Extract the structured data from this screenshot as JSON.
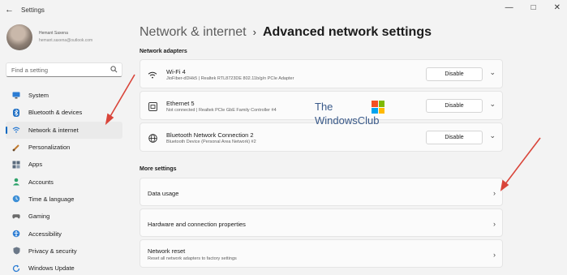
{
  "window": {
    "title": "Settings",
    "controls": [
      "—",
      "□",
      "✕"
    ]
  },
  "profile": {
    "name": "Hemant Saxena",
    "email": "hemant.saxena@outlook.com"
  },
  "search": {
    "placeholder": "Find a setting"
  },
  "sidebar": {
    "items": [
      {
        "label": "System",
        "icon": "monitor-icon",
        "active": false
      },
      {
        "label": "Bluetooth & devices",
        "icon": "bluetooth-icon",
        "active": false
      },
      {
        "label": "Network & internet",
        "icon": "wifi-icon",
        "active": true
      },
      {
        "label": "Personalization",
        "icon": "brush-icon",
        "active": false
      },
      {
        "label": "Apps",
        "icon": "apps-icon",
        "active": false
      },
      {
        "label": "Accounts",
        "icon": "person-icon",
        "active": false
      },
      {
        "label": "Time & language",
        "icon": "globe-clock-icon",
        "active": false
      },
      {
        "label": "Gaming",
        "icon": "gamepad-icon",
        "active": false
      },
      {
        "label": "Accessibility",
        "icon": "accessibility-icon",
        "active": false
      },
      {
        "label": "Privacy & security",
        "icon": "shield-icon",
        "active": false
      },
      {
        "label": "Windows Update",
        "icon": "update-icon",
        "active": false
      }
    ]
  },
  "breadcrumb": {
    "parent": "Network & internet",
    "separator": "›",
    "current": "Advanced network settings"
  },
  "network_adapters": {
    "title": "Network adapters",
    "items": [
      {
        "name": "Wi-Fi 4",
        "detail": "JioFiber-dDHk5 | Realtek RTL8723DE 802.11b/g/n PCIe Adapter",
        "button": "Disable",
        "icon": "wifi-icon"
      },
      {
        "name": "Ethernet 5",
        "detail": "Not connected | Realtek PCIe GbE Family Controller #4",
        "button": "Disable",
        "icon": "ethernet-icon"
      },
      {
        "name": "Bluetooth Network Connection 2",
        "detail": "Bluetooth Device (Personal Area Network) #2",
        "button": "Disable",
        "icon": "globe-icon"
      }
    ]
  },
  "more_settings": {
    "title": "More settings",
    "items": [
      {
        "name": "Data usage",
        "detail": ""
      },
      {
        "name": "Hardware and connection properties",
        "detail": ""
      },
      {
        "name": "Network reset",
        "detail": "Reset all network adapters to factory settings"
      }
    ]
  },
  "watermark": {
    "line1": "The",
    "line2": "WindowsClub"
  },
  "colors": {
    "accent": "#0067c0",
    "arrow": "#d9453a",
    "background": "#f3f3f3"
  }
}
